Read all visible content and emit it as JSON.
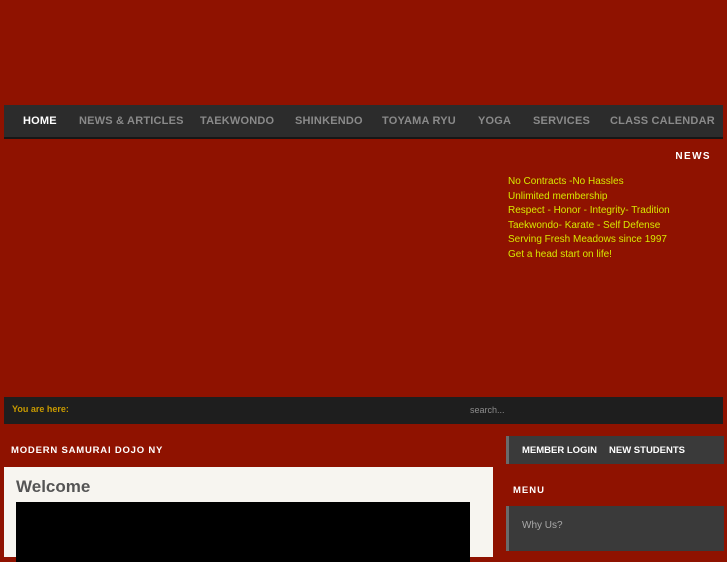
{
  "nav": {
    "items": [
      {
        "label": "HOME",
        "active": true
      },
      {
        "label": "NEWS & ARTICLES"
      },
      {
        "label": "TAEKWONDO"
      },
      {
        "label": "SHINKENDO"
      },
      {
        "label": "TOYAMA RYU"
      },
      {
        "label": "YOGA"
      },
      {
        "label": "SERVICES"
      },
      {
        "label": "CLASS CALENDAR"
      }
    ]
  },
  "news": {
    "heading": "NEWS",
    "items": [
      "No Contracts -No Hassles",
      "Unlimited membership",
      "Respect - Honor - Integrity- Tradition",
      "Taekwondo- Karate - Self Defense",
      "Serving Fresh Meadows since 1997",
      "Get a head start on life!"
    ]
  },
  "breadcrumb": {
    "label": "You are here:"
  },
  "search": {
    "placeholder": "search..."
  },
  "main": {
    "site_title": "MODERN SAMURAI DOJO NY",
    "welcome": "Welcome"
  },
  "sidebar": {
    "member_login": "MEMBER LOGIN",
    "new_students": "NEW STUDENTS",
    "menu_heading": "MENU",
    "menu_items": [
      "Why Us?"
    ]
  },
  "colors": {
    "page_bg": "#8f1200",
    "nav_bg": "#2c2c2c",
    "news_text": "#d8e800",
    "breadcrumb_label": "#c89a00"
  }
}
